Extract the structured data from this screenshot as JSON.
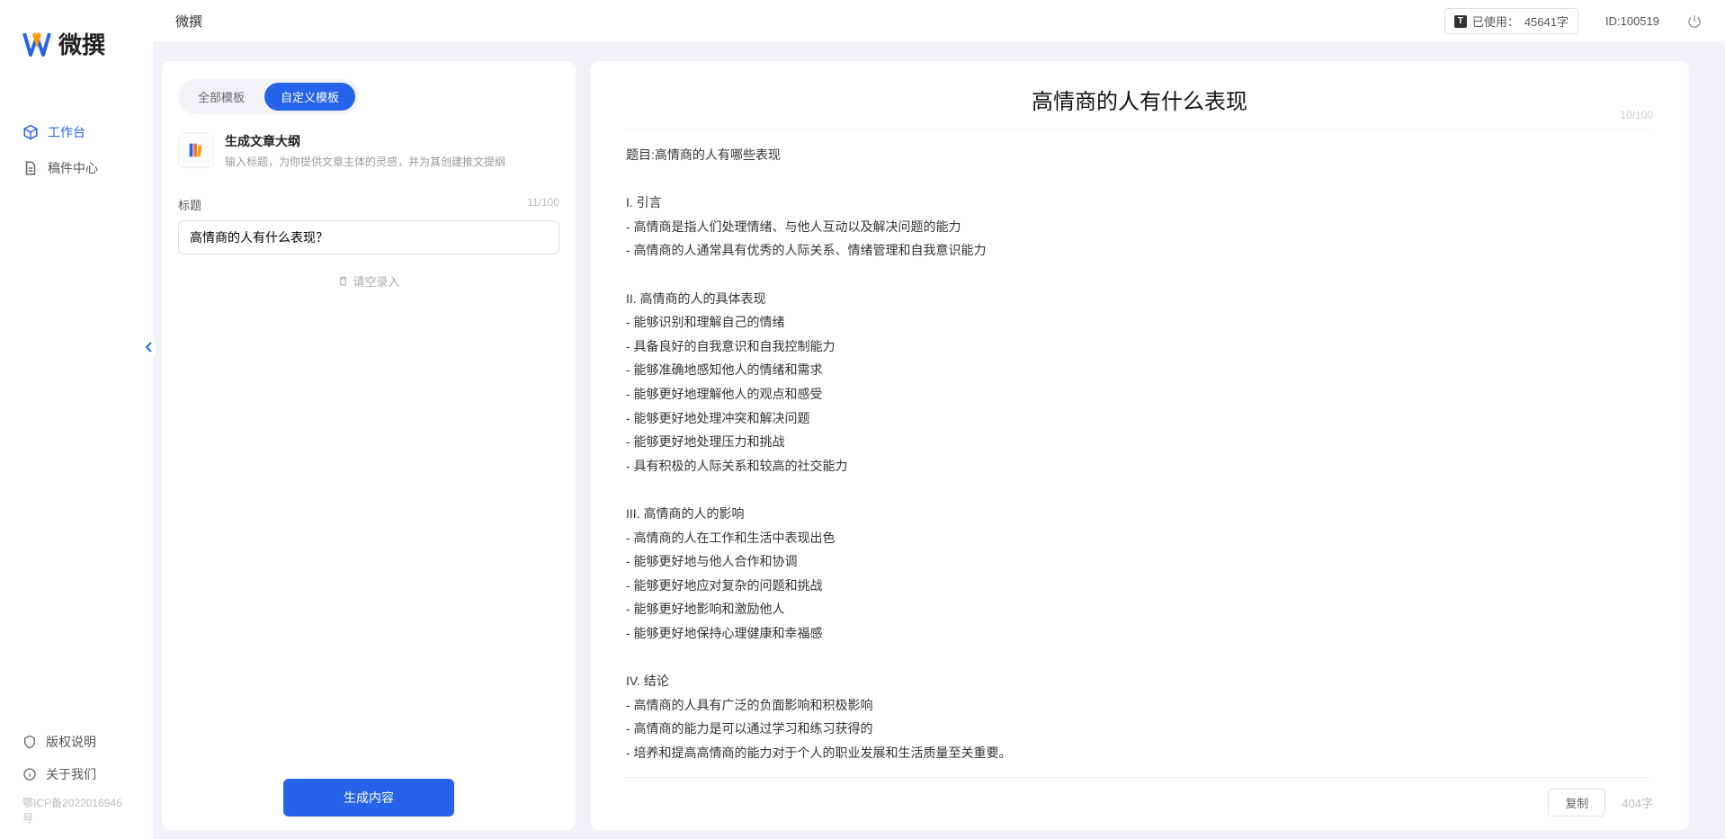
{
  "app": {
    "logo_text": "微撰",
    "topbar_title": "微撰"
  },
  "nav": {
    "items": [
      {
        "label": "工作台"
      },
      {
        "label": "稿件中心"
      }
    ]
  },
  "sidebar_bottom": {
    "copyright": "版权说明",
    "about": "关于我们",
    "icp": "鄂ICP备2022016946号"
  },
  "topbar": {
    "usage_label": "已使用：",
    "usage_value": "45641字",
    "userid_label": "ID:",
    "userid_value": "100519"
  },
  "left": {
    "tabs": [
      {
        "label": "全部模板"
      },
      {
        "label": "自定义模板"
      }
    ],
    "template": {
      "title": "生成文章大纲",
      "desc": "输入标题，为你提供文章主体的灵感，并为其创建推文提纲"
    },
    "field_label": "标题",
    "field_counter": "11/100",
    "input_value": "高情商的人有什么表现？",
    "clear_label": "请空录入",
    "generate_label": "生成内容"
  },
  "right": {
    "title": "高情商的人有什么表现",
    "title_counter": "10/100",
    "body": "题目:高情商的人有哪些表现\n\nI. 引言\n- 高情商是指人们处理情绪、与他人互动以及解决问题的能力\n- 高情商的人通常具有优秀的人际关系、情绪管理和自我意识能力\n\nII. 高情商的人的具体表现\n- 能够识别和理解自己的情绪\n- 具备良好的自我意识和自我控制能力\n- 能够准确地感知他人的情绪和需求\n- 能够更好地理解他人的观点和感受\n- 能够更好地处理冲突和解决问题\n- 能够更好地处理压力和挑战\n- 具有积极的人际关系和较高的社交能力\n\nIII. 高情商的人的影响\n- 高情商的人在工作和生活中表现出色\n- 能够更好地与他人合作和协调\n- 能够更好地应对复杂的问题和挑战\n- 能够更好地影响和激励他人\n- 能够更好地保持心理健康和幸福感\n\nIV. 结论\n- 高情商的人具有广泛的负面影响和积极影响\n- 高情商的能力是可以通过学习和练习获得的\n- 培养和提高高情商的能力对于个人的职业发展和生活质量至关重要。",
    "copy_label": "复制",
    "word_count": "404字"
  }
}
